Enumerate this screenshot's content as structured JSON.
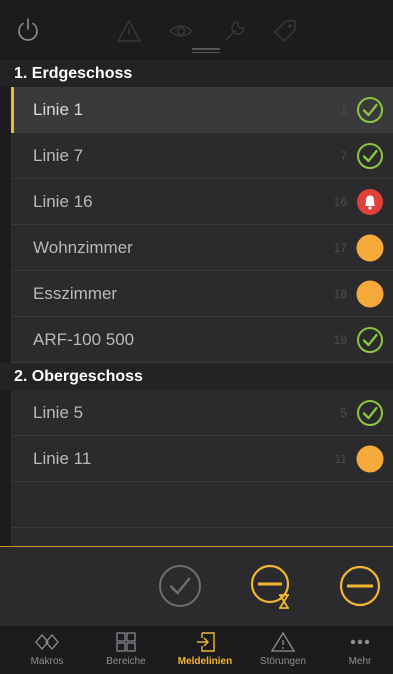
{
  "sections": [
    {
      "title": "1. Erdgeschoss",
      "rows": [
        {
          "label": "Linie 1",
          "number": "1",
          "status": "ok"
        },
        {
          "label": "Linie  7",
          "number": "7",
          "status": "ok"
        },
        {
          "label": "Linie 16",
          "number": "16",
          "status": "alarm"
        },
        {
          "label": "Wohnzimmer",
          "number": "17",
          "status": "warning"
        },
        {
          "label": "Esszimmer",
          "number": "18",
          "status": "warning"
        },
        {
          "label": "ARF-100 500",
          "number": "19",
          "status": "ok"
        }
      ]
    },
    {
      "title": "2. Obergeschoss",
      "rows": [
        {
          "label": "Linie  5",
          "number": "5",
          "status": "ok"
        },
        {
          "label": "Linie 11",
          "number": "11",
          "status": "warning"
        }
      ]
    }
  ],
  "top_icons": [
    "power-icon",
    "warning-icon",
    "eye-icon",
    "wrench-icon",
    "tag-icon"
  ],
  "actions": [
    "check-icon",
    "block-timer-icon",
    "block-icon"
  ],
  "tabs": [
    {
      "label": "Makros",
      "icon": "makros-icon",
      "active": false
    },
    {
      "label": "Bereiche",
      "icon": "grid-icon",
      "active": false
    },
    {
      "label": "Meldelinien",
      "icon": "login-arrow-icon",
      "active": true
    },
    {
      "label": "Störungen",
      "icon": "warning-icon",
      "active": false
    },
    {
      "label": "Mehr",
      "icon": "more-icon",
      "active": false
    }
  ],
  "colors": {
    "accent": "#f2b632",
    "ok": "#8dc63f",
    "alarm": "#e0403a",
    "warning": "#f5a93a",
    "background": "#1c1c1e",
    "row": "#2b2b2d"
  }
}
